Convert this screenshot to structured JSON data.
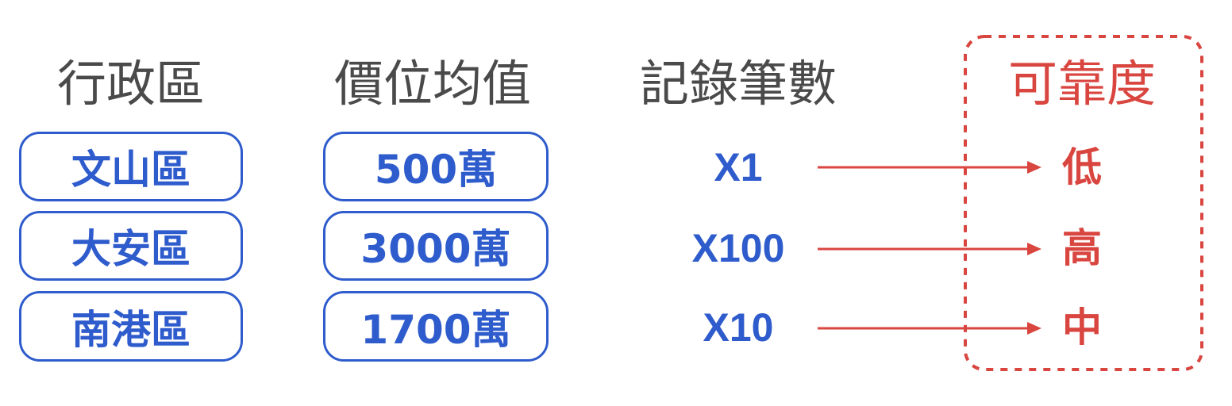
{
  "headers": {
    "district": "行政區",
    "price": "價位均值",
    "records": "記錄筆數",
    "reliability": "可靠度"
  },
  "rows": [
    {
      "district": "文山區",
      "price": "500萬",
      "records": "X1",
      "reliability": "低"
    },
    {
      "district": "大安區",
      "price": "3000萬",
      "records": "X100",
      "reliability": "高"
    },
    {
      "district": "南港區",
      "price": "1700萬",
      "records": "X10",
      "reliability": "中"
    }
  ],
  "colors": {
    "blue": "#2f5ccc",
    "red": "#d9453f",
    "header_gray": "#4a4a4a"
  }
}
